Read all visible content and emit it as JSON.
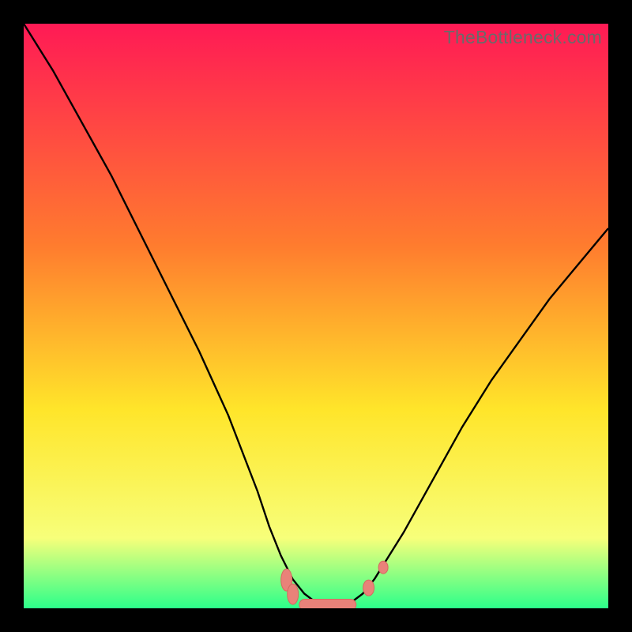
{
  "watermark": "TheBottleneck.com",
  "colors": {
    "frame": "#000000",
    "gradient_top": "#ff1a55",
    "gradient_mid1": "#ff7c2e",
    "gradient_mid2": "#ffe52a",
    "gradient_mid3": "#f7ff7a",
    "gradient_bottom": "#2cff8a",
    "curve": "#000000",
    "marker_fill": "#e98279",
    "marker_stroke": "#d46a60"
  },
  "chart_data": {
    "type": "line",
    "title": "",
    "xlabel": "",
    "ylabel": "",
    "xlim": [
      0,
      100
    ],
    "ylim": [
      0,
      100
    ],
    "series": [
      {
        "name": "bottleneck-curve",
        "x": [
          0,
          5,
          10,
          15,
          20,
          25,
          30,
          35,
          40,
          42,
          44,
          46,
          48,
          50,
          52,
          54,
          56,
          58,
          60,
          65,
          70,
          75,
          80,
          85,
          90,
          95,
          100
        ],
        "y": [
          100,
          92,
          83,
          74,
          64,
          54,
          44,
          33,
          20,
          14,
          9,
          5,
          2.5,
          1,
          0.5,
          0.5,
          1,
          2.5,
          5,
          13,
          22,
          31,
          39,
          46,
          53,
          59,
          65
        ]
      }
    ],
    "markers": [
      {
        "name": "left-cluster",
        "x": 45.5,
        "y": 3.5
      },
      {
        "name": "valley-blob",
        "x": 52,
        "y": 0.6
      },
      {
        "name": "right-dot-low",
        "x": 59,
        "y": 3.5
      },
      {
        "name": "right-dot-hi",
        "x": 61.5,
        "y": 7.0
      }
    ],
    "legend": [],
    "annotations": [
      {
        "text": "TheBottleneck.com",
        "pos": "top-right"
      }
    ]
  }
}
